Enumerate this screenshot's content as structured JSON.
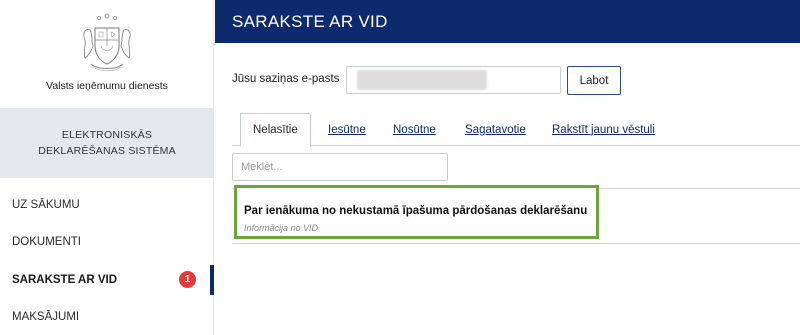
{
  "sidebar": {
    "org_name": "Valsts ieņēmumu dienests",
    "system_title_line1": "ELEKTRONISKĀS",
    "system_title_line2": "DEKLARĒŠANAS SISTĒMA",
    "nav": [
      {
        "label": "UZ SĀKUMU"
      },
      {
        "label": "DOKUMENTI"
      },
      {
        "label": "SARAKSTE AR VID",
        "badge": "1",
        "active": true
      },
      {
        "label": "MAKSĀJUMI"
      }
    ]
  },
  "header": {
    "title": "SARAKSTE AR VID",
    "color": "#0e2a6e"
  },
  "email": {
    "label": "Jūsu saziņas e-pasts",
    "value": "",
    "edit_label": "Labot"
  },
  "tabs": [
    {
      "label": "Nelasītie",
      "active": true
    },
    {
      "label": "Iesūtne"
    },
    {
      "label": "Nosūtne"
    },
    {
      "label": "Sagatavotie"
    },
    {
      "label": "Rakstīt jaunu vēstuli"
    }
  ],
  "search": {
    "placeholder": "Meklēt..."
  },
  "messages": [
    {
      "subject": "Par ienākuma no nekustamā īpašuma pārdošanas deklarēšanu",
      "from": "Informācija no VID",
      "highlight_color": "#6ba63c"
    }
  ],
  "icons": {
    "logo": "latvia-coat-of-arms-icon"
  },
  "colors": {
    "badge": "#e33b3b",
    "accent": "#0e2a6e"
  }
}
